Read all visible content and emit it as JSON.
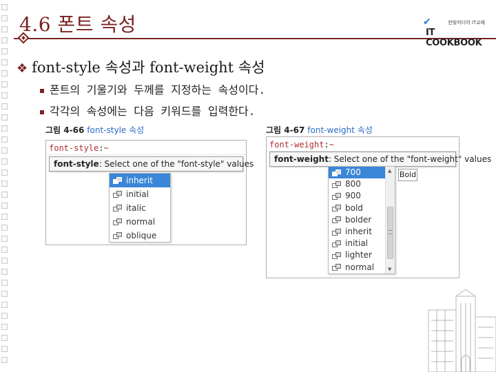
{
  "slide": {
    "title": "4.6 폰트 속성",
    "logo_top": "한빛미디어 IT교재",
    "logo_main": "IT COOKBOOK",
    "main_bullet": "font-style 속성과 font-weight 속성",
    "sub_bullets": [
      "폰트의 기울기와 두께를 지정하는 속성이다.",
      "각각의 속성에는 다음 키워드를 입력한다."
    ]
  },
  "figure1": {
    "caption_num": "그림 4-66",
    "caption_name": "font-style 속성",
    "code_prop": "font-style",
    "code_colon": ":",
    "code_cursor": "~",
    "hint_prop": "font-style",
    "hint_text": ": Select one of the \"font-style\" values",
    "items": [
      "inherit",
      "initial",
      "italic",
      "normal",
      "oblique"
    ],
    "selected_index": 0
  },
  "figure2": {
    "caption_num": "그림 4-67",
    "caption_name": "font-weight 속성",
    "code_prop": "font-weight",
    "code_colon": ":",
    "code_cursor": "~",
    "hint_prop": "font-weight",
    "hint_text": ": Select one of the \"font-weight\" values",
    "items": [
      "700",
      "800",
      "900",
      "bold",
      "bolder",
      "inherit",
      "initial",
      "lighter",
      "normal"
    ],
    "selected_index": 0,
    "tooltip": "Bold"
  },
  "colors": {
    "accent": "#7a2222",
    "selection": "#3a86d8",
    "caption_link": "#2b6cc4"
  }
}
